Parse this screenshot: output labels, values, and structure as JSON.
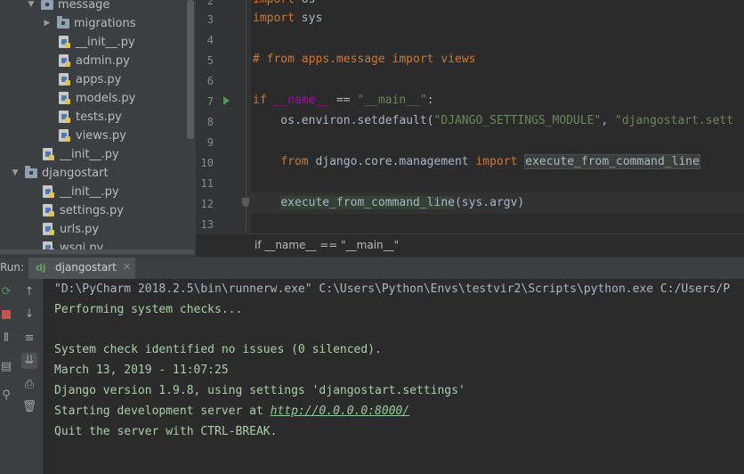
{
  "project_tree": {
    "items": [
      {
        "label": "message",
        "arrow": "▼",
        "type": "folder"
      },
      {
        "label": "migrations",
        "arrow": "▶",
        "type": "folder"
      },
      {
        "label": "__init__.py",
        "arrow": "",
        "type": "py"
      },
      {
        "label": "admin.py",
        "arrow": "",
        "type": "py"
      },
      {
        "label": "apps.py",
        "arrow": "",
        "type": "py"
      },
      {
        "label": "models.py",
        "arrow": "",
        "type": "py"
      },
      {
        "label": "tests.py",
        "arrow": "",
        "type": "py"
      },
      {
        "label": "views.py",
        "arrow": "",
        "type": "py"
      },
      {
        "label": "__init__.py",
        "arrow": "",
        "type": "py"
      },
      {
        "label": "djangostart",
        "arrow": "▼",
        "type": "folder"
      },
      {
        "label": "__init__.py",
        "arrow": "",
        "type": "py"
      },
      {
        "label": "settings.py",
        "arrow": "",
        "type": "py"
      },
      {
        "label": "urls.py",
        "arrow": "",
        "type": "py"
      },
      {
        "label": "wsgi.py",
        "arrow": "",
        "type": "py"
      }
    ]
  },
  "editor": {
    "line_numbers": [
      "2",
      "3",
      "4",
      "5",
      "6",
      "7",
      "8",
      "9",
      "10",
      "11",
      "12",
      "13"
    ],
    "code": {
      "l2_kw": "import",
      "l2_rest": " os",
      "l3_kw": "import",
      "l3_rest": " sys",
      "l5": "# from apps.message import views",
      "l7_kw": "if",
      "l7_dunder": "__name__",
      "l7_op": " == ",
      "l7_str": "\"__main__\"",
      "l7_colon": ":",
      "l8_a": "    os.environ.setdefault(",
      "l8_str1": "\"DJANGO_SETTINGS_MODULE\"",
      "l8_b": ", ",
      "l8_str2": "\"djangostart.sett",
      "l10_kw1": "from",
      "l10_mod": " django.core.management ",
      "l10_kw2": "import",
      "l10_name": "execute_from_command_line",
      "l12_name": "execute_from_command_line",
      "l12_rest": "(sys.argv)"
    },
    "breadcrumb": "if __name__ == \"__main__\""
  },
  "run_panel": {
    "label": "Run:",
    "tab_icon": "dj",
    "tab_label": "djangostart",
    "tab_close": "✕",
    "console_lines": [
      "\"D:\\PyCharm 2018.2.5\\bin\\runnerw.exe\" C:\\Users\\Python\\Envs\\testvir2\\Scripts\\python.exe C:/Users/P",
      "Performing system checks...",
      "",
      "System check identified no issues (0 silenced).",
      "March 13, 2019 - 11:07:25",
      "Django version 1.9.8, using settings 'djangostart.settings'",
      "Starting development server at ",
      "Quit the server with CTRL-BREAK."
    ],
    "server_url": "http://0.0.0.0:8000/"
  },
  "colors": {
    "keyword": "#cc7832",
    "string": "#6a8759",
    "dunder": "#b200b2",
    "console_text": "#a9cfa9",
    "run_green": "#499c54",
    "stop_red": "#c75450"
  }
}
